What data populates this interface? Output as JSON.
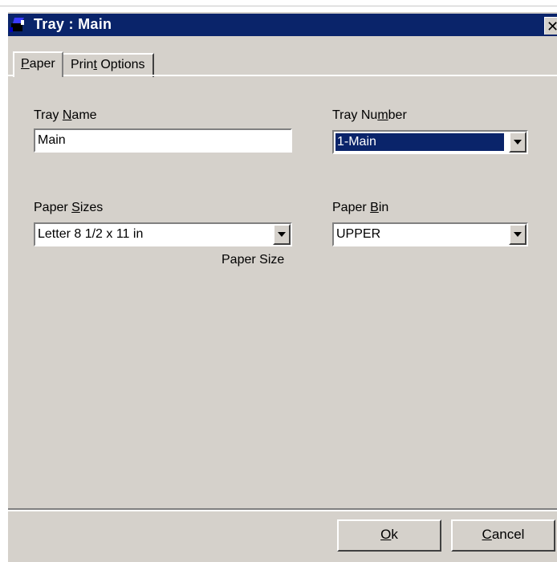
{
  "window": {
    "title": "Tray : Main",
    "close_glyph": "✕"
  },
  "tabs": [
    {
      "label_ul": "P",
      "label_rest": "aper",
      "active": true
    },
    {
      "label_pre": "Prin",
      "label_ul": "t",
      "label_rest": " Options",
      "active": false
    }
  ],
  "form": {
    "tray_name_label_pre": "Tray ",
    "tray_name_label_ul": "N",
    "tray_name_label_rest": "ame",
    "tray_name_value": "Main",
    "tray_number_label_pre": "Tray Nu",
    "tray_number_label_ul": "m",
    "tray_number_label_rest": "ber",
    "tray_number_value": "1-Main",
    "paper_sizes_label_pre": "Paper ",
    "paper_sizes_label_ul": "S",
    "paper_sizes_label_rest": "izes",
    "paper_sizes_value": "Letter 8 1/2 x 11 in",
    "paper_size_caption": "Paper Size",
    "paper_bin_label_pre": "Paper ",
    "paper_bin_label_ul": "B",
    "paper_bin_label_rest": "in",
    "paper_bin_value": "UPPER"
  },
  "buttons": {
    "ok_ul": "O",
    "ok_rest": "k",
    "cancel_ul": "C",
    "cancel_rest": "ancel"
  },
  "colors": {
    "titlebar": "#0a246a",
    "face": "#d5d1cb",
    "selection": "#0a246a"
  },
  "icons": [
    "printer-tray-icon",
    "close-icon",
    "dropdown-arrow-icon"
  ]
}
